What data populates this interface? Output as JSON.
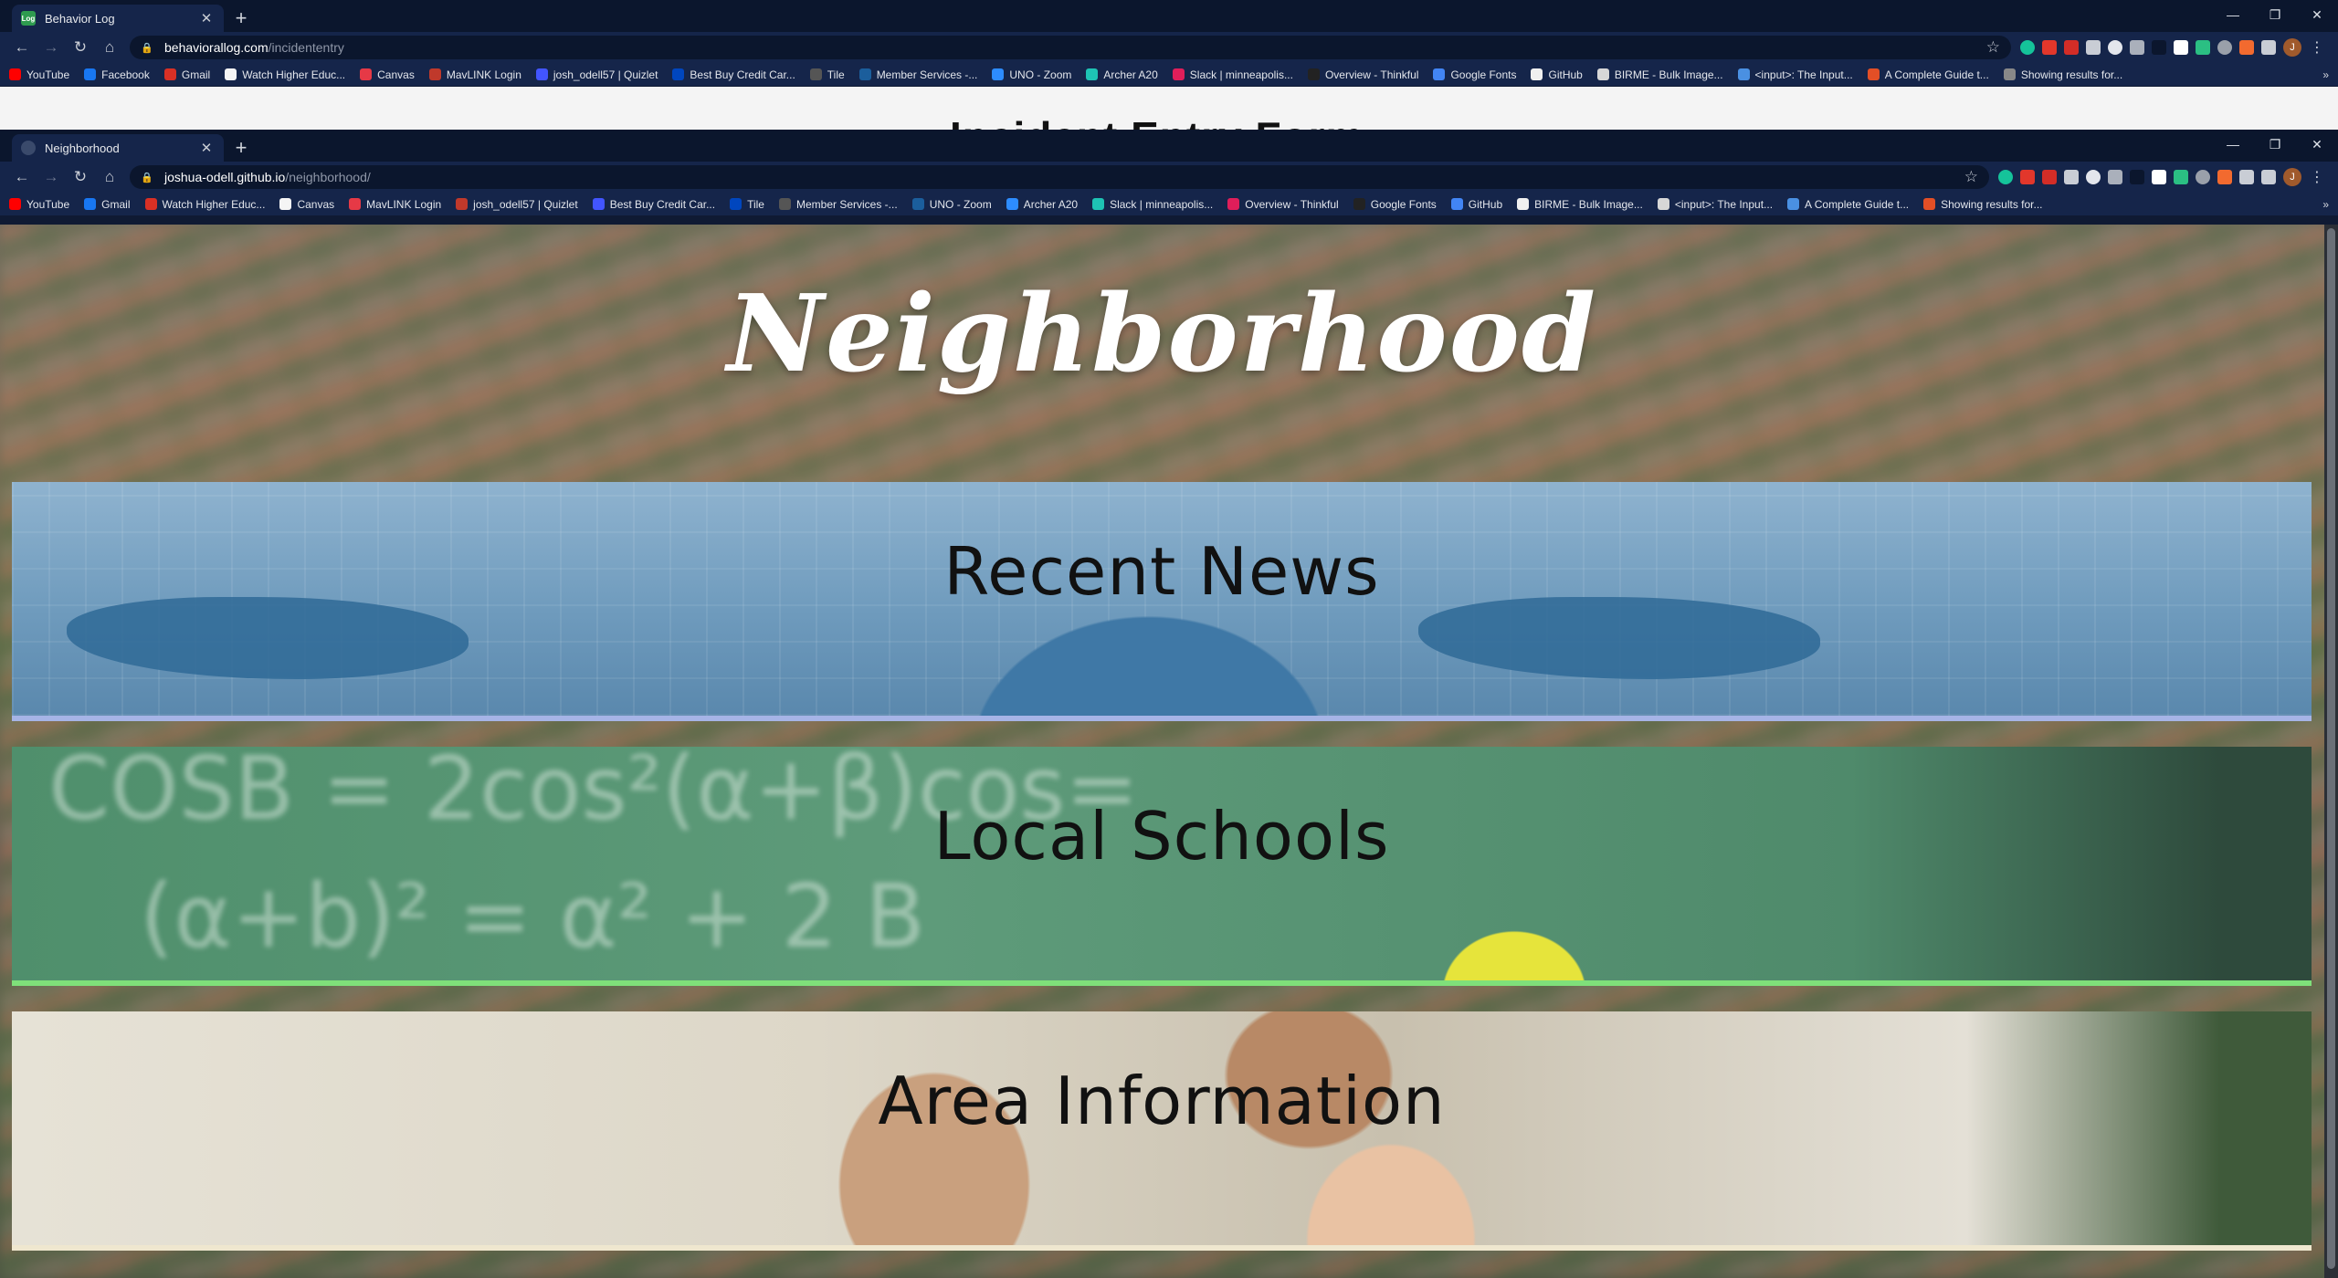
{
  "back_window": {
    "tab": {
      "title": "Behavior Log",
      "favicon": "Log"
    },
    "url": {
      "host": "behaviorallog.com",
      "path": "/incidententry"
    },
    "page_heading": "Incident Entry Form"
  },
  "front_window": {
    "tab": {
      "title": "Neighborhood"
    },
    "url": {
      "host": "joshua-odell.github.io",
      "path": "/neighborhood/"
    }
  },
  "bookmarks_back": [
    "YouTube",
    "Facebook",
    "Gmail",
    "Watch Higher Educ...",
    "Canvas",
    "MavLINK Login",
    "josh_odell57 | Quizlet",
    "Best Buy Credit Car...",
    "Tile",
    "Member Services -...",
    "UNO - Zoom",
    "Archer A20",
    "Slack | minneapolis...",
    "Overview - Thinkful",
    "Google Fonts",
    "GitHub",
    "BIRME - Bulk Image...",
    "<input>: The Input...",
    "A Complete Guide t...",
    "Showing results for..."
  ],
  "bookmarks_front": [
    "YouTube",
    "Gmail",
    "Watch Higher Educ...",
    "Canvas",
    "MavLINK Login",
    "josh_odell57 | Quizlet",
    "Best Buy Credit Car...",
    "Tile",
    "Member Services -...",
    "UNO - Zoom",
    "Archer A20",
    "Slack | minneapolis...",
    "Overview - Thinkful",
    "Google Fonts",
    "GitHub",
    "BIRME - Bulk Image...",
    "<input>: The Input...",
    "A Complete Guide t...",
    "Showing results for..."
  ],
  "profile_initial": "J",
  "page": {
    "title": "Neighborhood",
    "cards": [
      {
        "label": "Recent News"
      },
      {
        "label": "Local Schools"
      },
      {
        "label": "Area Information"
      }
    ]
  },
  "colors": {
    "chrome_bg": "#15254a",
    "news_border": "#a6b4e6",
    "schools_border": "#7fe07a",
    "area_border": "#efe7cf"
  }
}
